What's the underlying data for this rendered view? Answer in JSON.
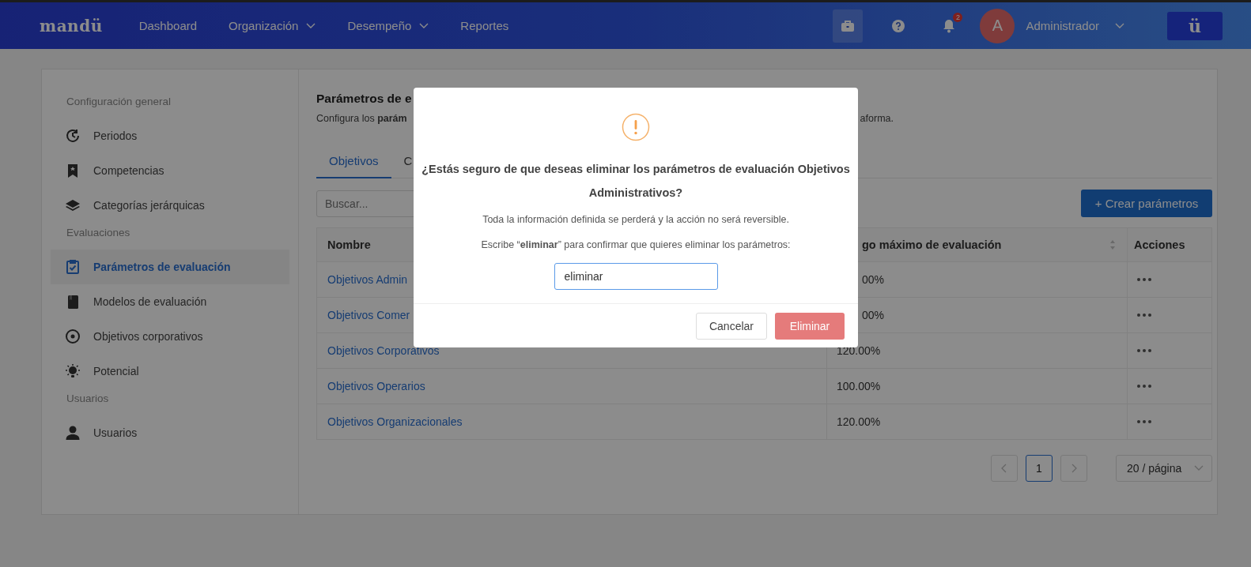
{
  "header": {
    "logo": "mandü",
    "nav": [
      {
        "label": "Dashboard",
        "dropdown": false
      },
      {
        "label": "Organización",
        "dropdown": true
      },
      {
        "label": "Desempeño",
        "dropdown": true
      },
      {
        "label": "Reportes",
        "dropdown": false
      }
    ],
    "notifications_badge": "2",
    "avatar_initial": "A",
    "user": "Administrador",
    "brand_button": "ü"
  },
  "sidebar": {
    "sections": [
      {
        "title": "Configuración general",
        "items": [
          {
            "label": "Periodos",
            "selected": false
          },
          {
            "label": "Competencias",
            "selected": false
          },
          {
            "label": "Categorías jerárquicas",
            "selected": false
          }
        ]
      },
      {
        "title": "Evaluaciones",
        "items": [
          {
            "label": "Parámetros de evaluación",
            "selected": true
          },
          {
            "label": "Modelos de evaluación",
            "selected": false
          },
          {
            "label": "Objetivos corporativos",
            "selected": false
          },
          {
            "label": "Potencial",
            "selected": false
          }
        ]
      },
      {
        "title": "Usuarios",
        "items": [
          {
            "label": "Usuarios",
            "selected": false
          }
        ]
      }
    ]
  },
  "content": {
    "title": "Parámetros de e",
    "description_start": "Configura los **parám**",
    "description_end": "aforma.",
    "tabs": [
      {
        "label": "Objetivos",
        "selected": true
      },
      {
        "label": "C",
        "selected": false
      }
    ],
    "search": {
      "placeholder": "Buscar..."
    },
    "create_button": "+ Crear parámetros",
    "table": {
      "columns": [
        "Nombre",
        "go máximo de evaluación",
        "Acciones"
      ],
      "rows": [
        {
          "name": "Objetivos Admin",
          "max": "00%"
        },
        {
          "name": "Objetivos Comer",
          "max": "00%"
        },
        {
          "name": "Objetivos Corporativos",
          "max": "120.00%"
        },
        {
          "name": "Objetivos Operarios",
          "max": "100.00%"
        },
        {
          "name": "Objetivos Organizacionales",
          "max": "120.00%"
        }
      ]
    },
    "pagination": {
      "pages": [
        {
          "label": "1",
          "selected": true
        }
      ],
      "page_size": "20 / página"
    }
  },
  "dialog": {
    "title": "¿Estás seguro de que deseas eliminar los parámetros de evaluación Objetivos Administrativos?",
    "message": "Toda la información definida se perderá y la acción no será reversible.",
    "instruction": "Escribe “**eliminar**” para confirmar que quieres eliminar los parámetros:",
    "input_value": "eliminar",
    "buttons": [
      {
        "label": "Cancelar",
        "kind": "secondary"
      },
      {
        "label": "Eliminar",
        "kind": "danger"
      }
    ]
  }
}
